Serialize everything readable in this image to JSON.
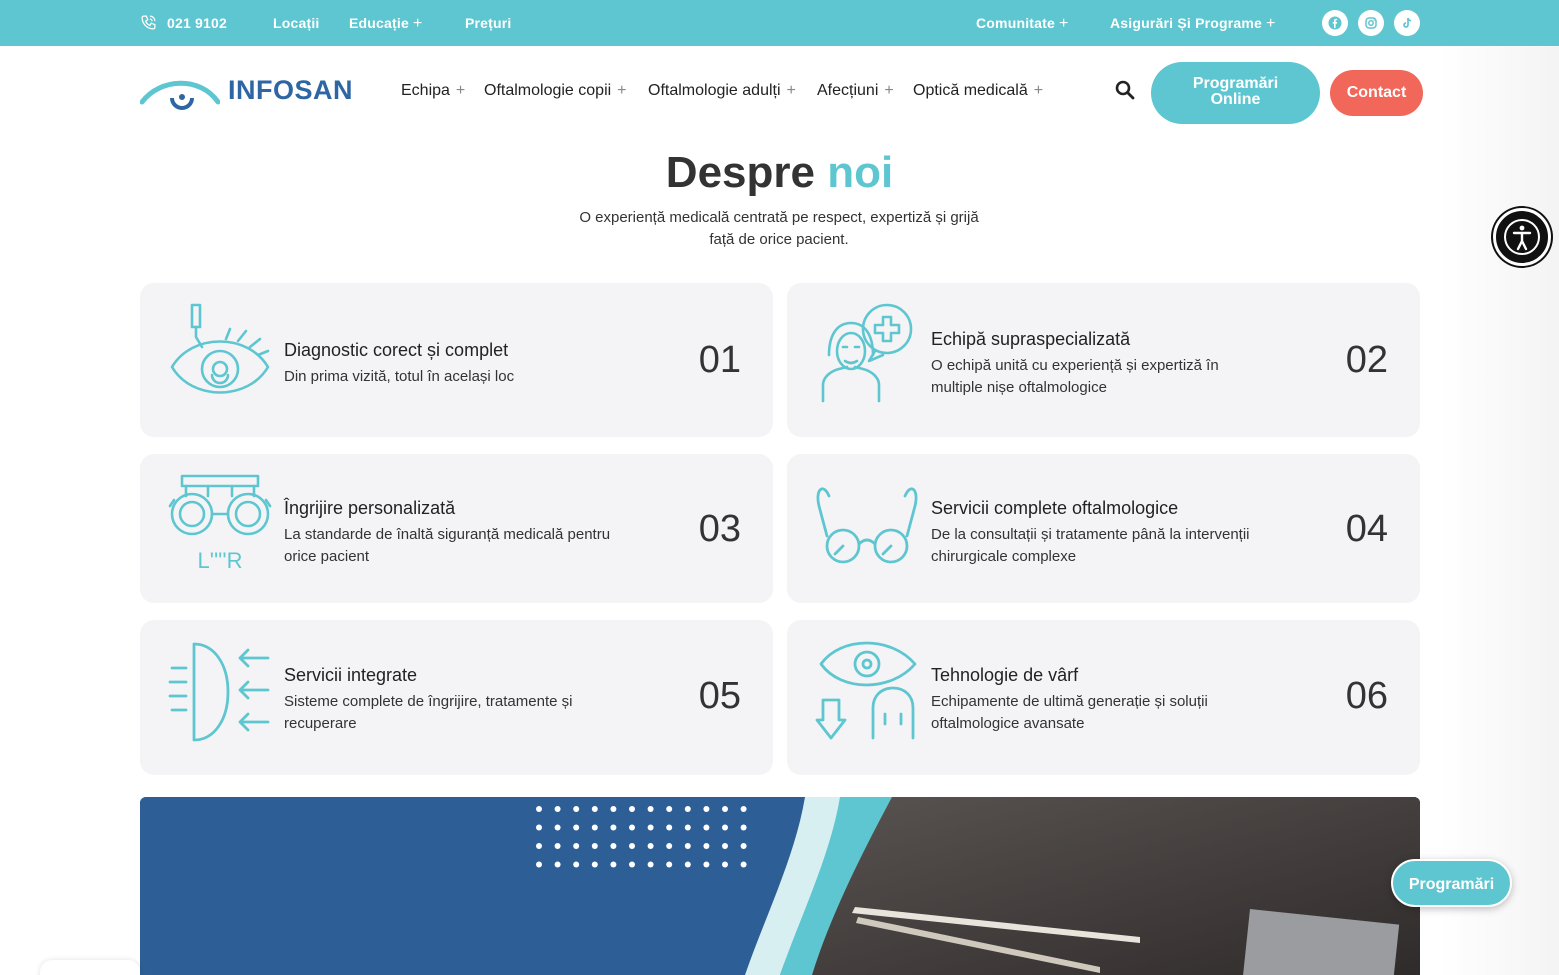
{
  "topbar": {
    "phone": "021 9102",
    "links": [
      "Locații",
      "Educație",
      "Prețuri"
    ],
    "right_links": [
      "Comunitate",
      "Asigurări Și Programe"
    ],
    "plus": "+",
    "social_icons": [
      "facebook-icon",
      "instagram-icon",
      "tiktok-icon"
    ]
  },
  "header": {
    "logo_text": "INFOSAN",
    "nav": [
      "Echipa",
      "Oftalmologie copii",
      "Oftalmologie adulți",
      "Afecțiuni",
      "Optică medicală"
    ],
    "plus": "+",
    "programari_line1": "Programări",
    "programari_line2": "Online",
    "contact": "Contact"
  },
  "about": {
    "title_main": "Despre",
    "title_accent": "noi",
    "subtitle": "O experiență medicală centrată pe respect, expertiză și grijă față de orice pacient."
  },
  "cards": [
    {
      "title": "Diagnostic corect și complet",
      "desc": "Din prima vizită, totul în același loc",
      "number": "01",
      "icon": "eye-exam-icon"
    },
    {
      "title": "Echipă supraspecializată",
      "desc": "O echipă unită cu experiență și expertiză în multiple nișe oftalmologice",
      "number": "02",
      "icon": "doctor-icon"
    },
    {
      "title": "Îngrijire personalizată",
      "desc": "La standarde de înaltă siguranță medicală pentru orice pacient",
      "number": "03",
      "icon": "trial-frame-icon",
      "icon_label": "L''''R"
    },
    {
      "title": "Servicii complete oftalmologice",
      "desc": "De la consultații și tratamente până la intervenții chirurgicale complexe",
      "number": "04",
      "icon": "glasses-icon"
    },
    {
      "title": "Servicii integrate",
      "desc": "Sisteme complete de îngrijire, tratamente și recuperare",
      "number": "05",
      "icon": "lens-light-icon"
    },
    {
      "title": "Tehnologie de vârf",
      "desc": "Echipamente de ultimă generație și soluții oftalmologice avansate",
      "number": "06",
      "icon": "eye-scan-icon"
    }
  ],
  "floating": {
    "programari": "Programări",
    "accessibility_icon": "accessibility-icon"
  },
  "colors": {
    "accent": "#5ec6d0",
    "brand_blue": "#2d66a3",
    "contact": "#f1675a",
    "card_bg": "#f4f4f6",
    "banner_blue": "#2d5f96"
  }
}
